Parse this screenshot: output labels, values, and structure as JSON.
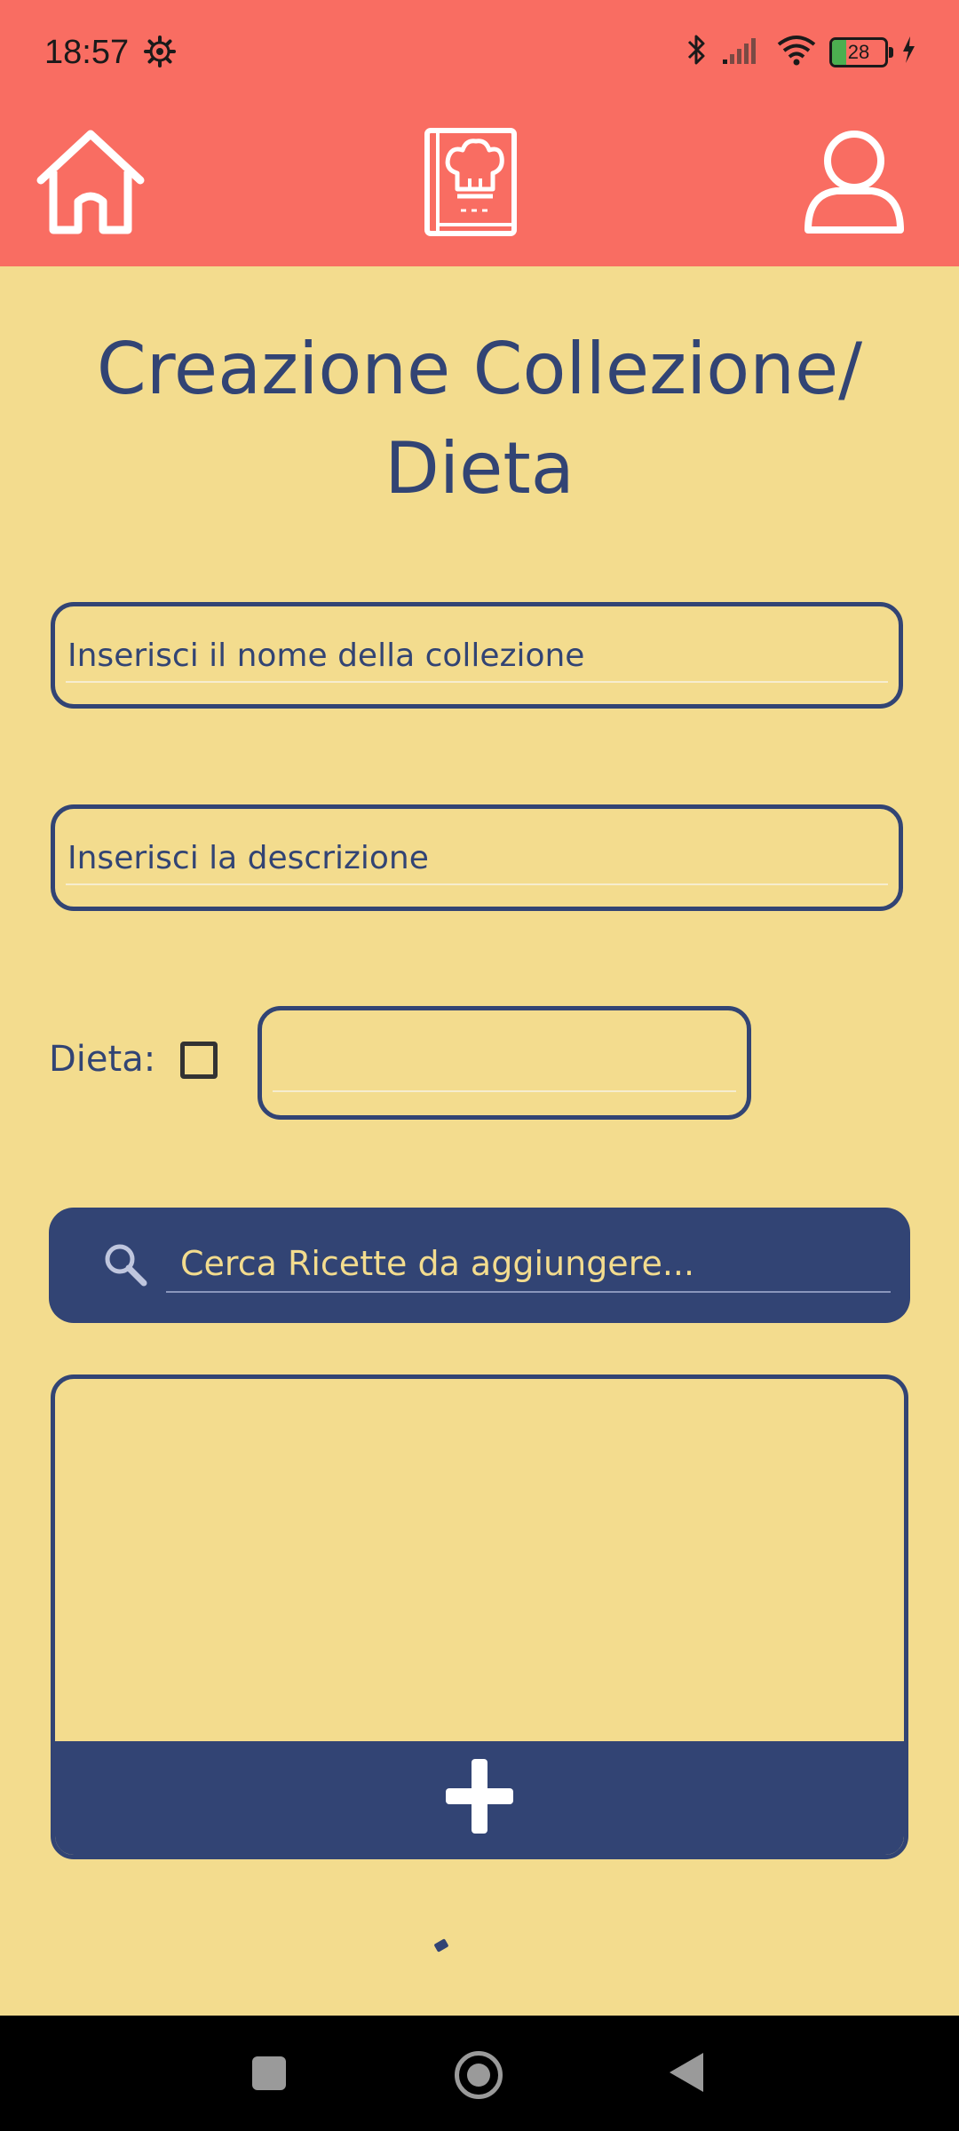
{
  "status_bar": {
    "time": "18:57",
    "battery_level": "28",
    "icons": [
      "settings-gear-icon",
      "bluetooth-icon",
      "signal-icon",
      "wifi-icon",
      "battery-icon",
      "charging-icon"
    ]
  },
  "app_bar": {
    "color": "#F96D62",
    "items": [
      "home-icon",
      "recipe-book-icon",
      "profile-icon"
    ]
  },
  "page": {
    "title_line1": "Creazione Collezione/",
    "title_line2": "Dieta"
  },
  "form": {
    "collection_name_placeholder": "Inserisci il nome della collezione",
    "description_placeholder": "Inserisci la descrizione",
    "diet_label": "Dieta:",
    "diet_checked": false,
    "diet_value": "",
    "search_placeholder": "Cerca Ricette da aggiungere..."
  },
  "recipe_list": {
    "items": [],
    "add_button_icon": "plus-icon"
  },
  "theme": {
    "background": "#F3DC8E",
    "primary": "#324474",
    "header": "#F96D62"
  }
}
